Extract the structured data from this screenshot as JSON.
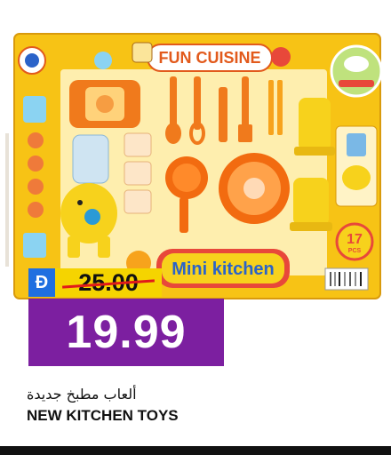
{
  "product": {
    "box_brand_title": "FUN CUISINE",
    "box_product_title": "Mini kitchen",
    "box_piece_count_number": "17",
    "box_piece_count_unit": "PCS"
  },
  "price": {
    "currency_symbol": "Đ",
    "old_price": "25.00",
    "new_price": "19.99"
  },
  "title": {
    "arabic": "ألعاب مطبخ جديدة",
    "english": "NEW KITCHEN TOYS"
  },
  "colors": {
    "accent_purple": "#7c1fa0",
    "price_yellow": "#f5d400",
    "currency_blue": "#1f6fe0",
    "strike_red": "#e11a1a"
  }
}
